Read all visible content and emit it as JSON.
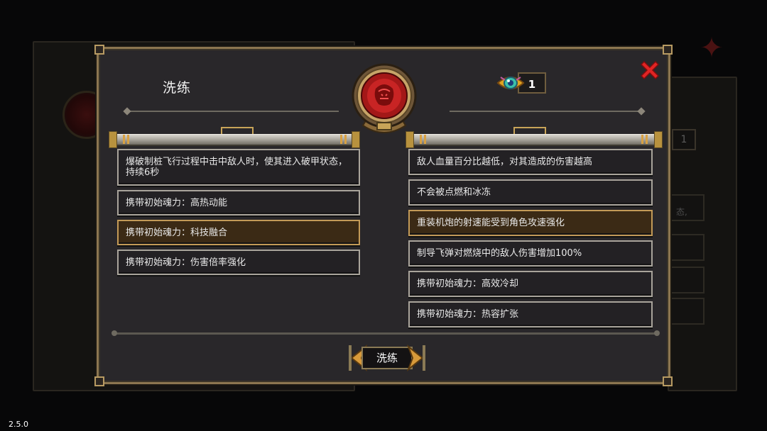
{
  "dialog": {
    "title": "洗练",
    "close_icon": "close-x-icon",
    "currency": {
      "icon": "eye-crystal-icon",
      "count": "1"
    },
    "emblem_icon": "red-demon-emblem-icon",
    "left_affixes": [
      {
        "text": "爆破制桩飞行过程中击中敌人时，使其进入破甲状态，持续6秒",
        "selected": false
      },
      {
        "text": "携带初始魂力：高热动能",
        "selected": false
      },
      {
        "text": "携带初始魂力：科技融合",
        "selected": true
      },
      {
        "text": "携带初始魂力：伤害倍率强化",
        "selected": false
      }
    ],
    "right_affixes": [
      {
        "text": "敌人血量百分比越低，对其造成的伤害越高",
        "selected": false
      },
      {
        "text": "不会被点燃和冰冻",
        "selected": false
      },
      {
        "text": "重装机炮的射速能受到角色攻速强化",
        "selected": true
      },
      {
        "text": "制导飞弹对燃烧中的敌人伤害增加100%",
        "selected": false
      },
      {
        "text": "携带初始魂力：高效冷却",
        "selected": false
      },
      {
        "text": "携带初始魂力：热容扩张",
        "selected": false
      }
    ],
    "action_button": "洗练"
  },
  "background": {
    "count": "1",
    "row_fragment": "态,"
  },
  "version": "2.5.0",
  "colors": {
    "panel": "#29272a",
    "gold_border": "#8c7650",
    "selected_row": "#3b2a15",
    "close_red": "#e02424"
  }
}
